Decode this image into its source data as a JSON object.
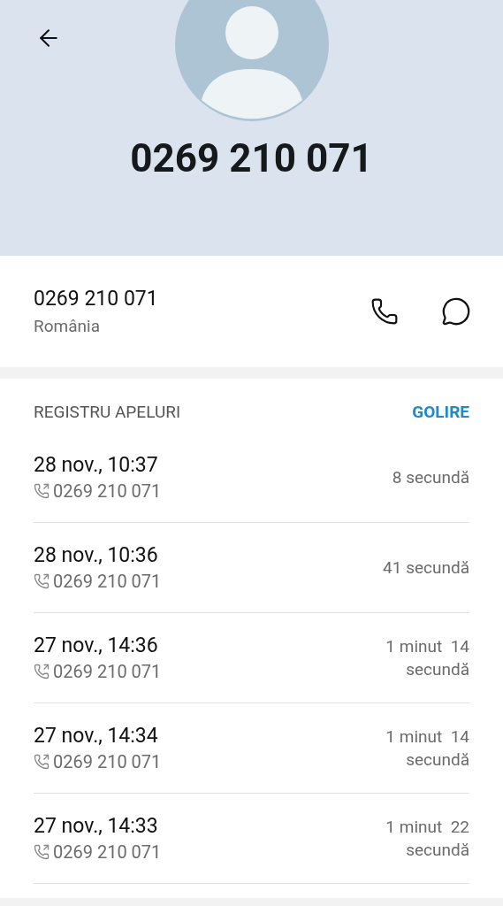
{
  "header": {
    "title": "0269 210 071"
  },
  "contact": {
    "number": "0269 210 071",
    "country": "România"
  },
  "call_log": {
    "title": "REGISTRU APELURI",
    "action": "GOLIRE",
    "rows": [
      {
        "date": "28 nov., 10:37",
        "number": "0269 210 071",
        "duration": "8 secundă"
      },
      {
        "date": "28 nov., 10:36",
        "number": "0269 210 071",
        "duration": "41 secundă"
      },
      {
        "date": "27 nov., 14:36",
        "number": "0269 210 071",
        "duration": "1 minut  14 secundă"
      },
      {
        "date": "27 nov., 14:34",
        "number": "0269 210 071",
        "duration": "1 minut  14 secundă"
      },
      {
        "date": "27 nov., 14:33",
        "number": "0269 210 071",
        "duration": "1 minut  22 secundă"
      }
    ]
  }
}
